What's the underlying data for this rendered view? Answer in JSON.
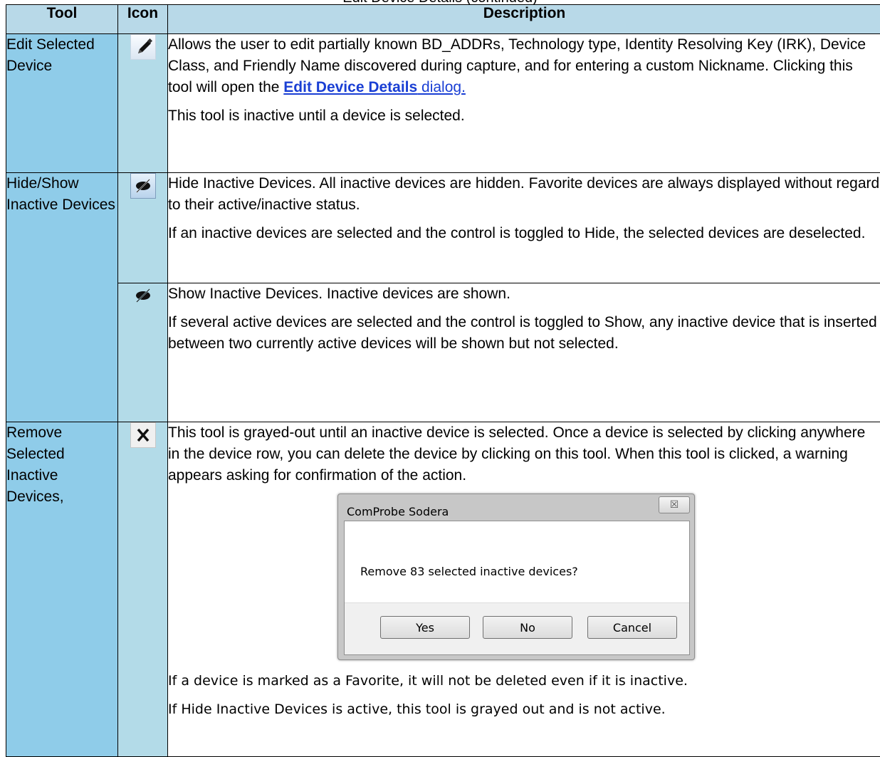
{
  "cutoff_text": "Edit Device Details (continued)",
  "headers": {
    "tool": "Tool",
    "icon": "Icon",
    "description": "Description"
  },
  "rows": {
    "edit": {
      "tool": "Edit Selected Device",
      "icon": "pencil-icon",
      "desc1": "Allows the user to edit partially known BD_ADDRs, Technology type, Identity Resolving Key (IRK), Device Class, and Friendly Name discovered during capture, and for entering a custom Nickname. Clicking this tool will open the ",
      "link_bold": "Edit Device Details",
      "link_rest": " dialog.",
      "desc2": "This tool is inactive until a device is selected."
    },
    "hide": {
      "tool": "Hide/Show Inactive Devices",
      "icon": "eye-hidden-icon",
      "desc1": "Hide Inactive Devices. All inactive devices are hidden. Favorite devices are always displayed without regard to their active/inactive status.",
      "desc2": "If an inactive devices are selected and the control is toggled to Hide, the selected devices are deselected."
    },
    "show": {
      "icon": "eye-icon",
      "desc1": "Show Inactive Devices. Inactive devices are shown.",
      "desc2": "If several active devices are selected and the control is toggled to Show, any inactive device that is inserted between two currently active devices will be shown but not selected."
    },
    "remove": {
      "tool": "Remove Selected Inactive Devices,",
      "icon": "x-icon",
      "desc1": "This tool is grayed-out until an inactive device is selected. Once a device is selected by clicking anywhere in the device row, you can delete the device by clicking on this tool. When this tool is clicked, a warning appears asking for confirmation of the action.",
      "desc2": "If a device is marked as a Favorite, it will not be deleted even if it is inactive.",
      "desc3": "If Hide Inactive Devices is active, this tool is grayed out and is not active."
    }
  },
  "dialog": {
    "title": "ComProbe Sodera",
    "close_label": "☒",
    "message": "Remove 83 selected inactive devices?",
    "buttons": {
      "yes": "Yes",
      "no": "No",
      "cancel": "Cancel"
    }
  }
}
